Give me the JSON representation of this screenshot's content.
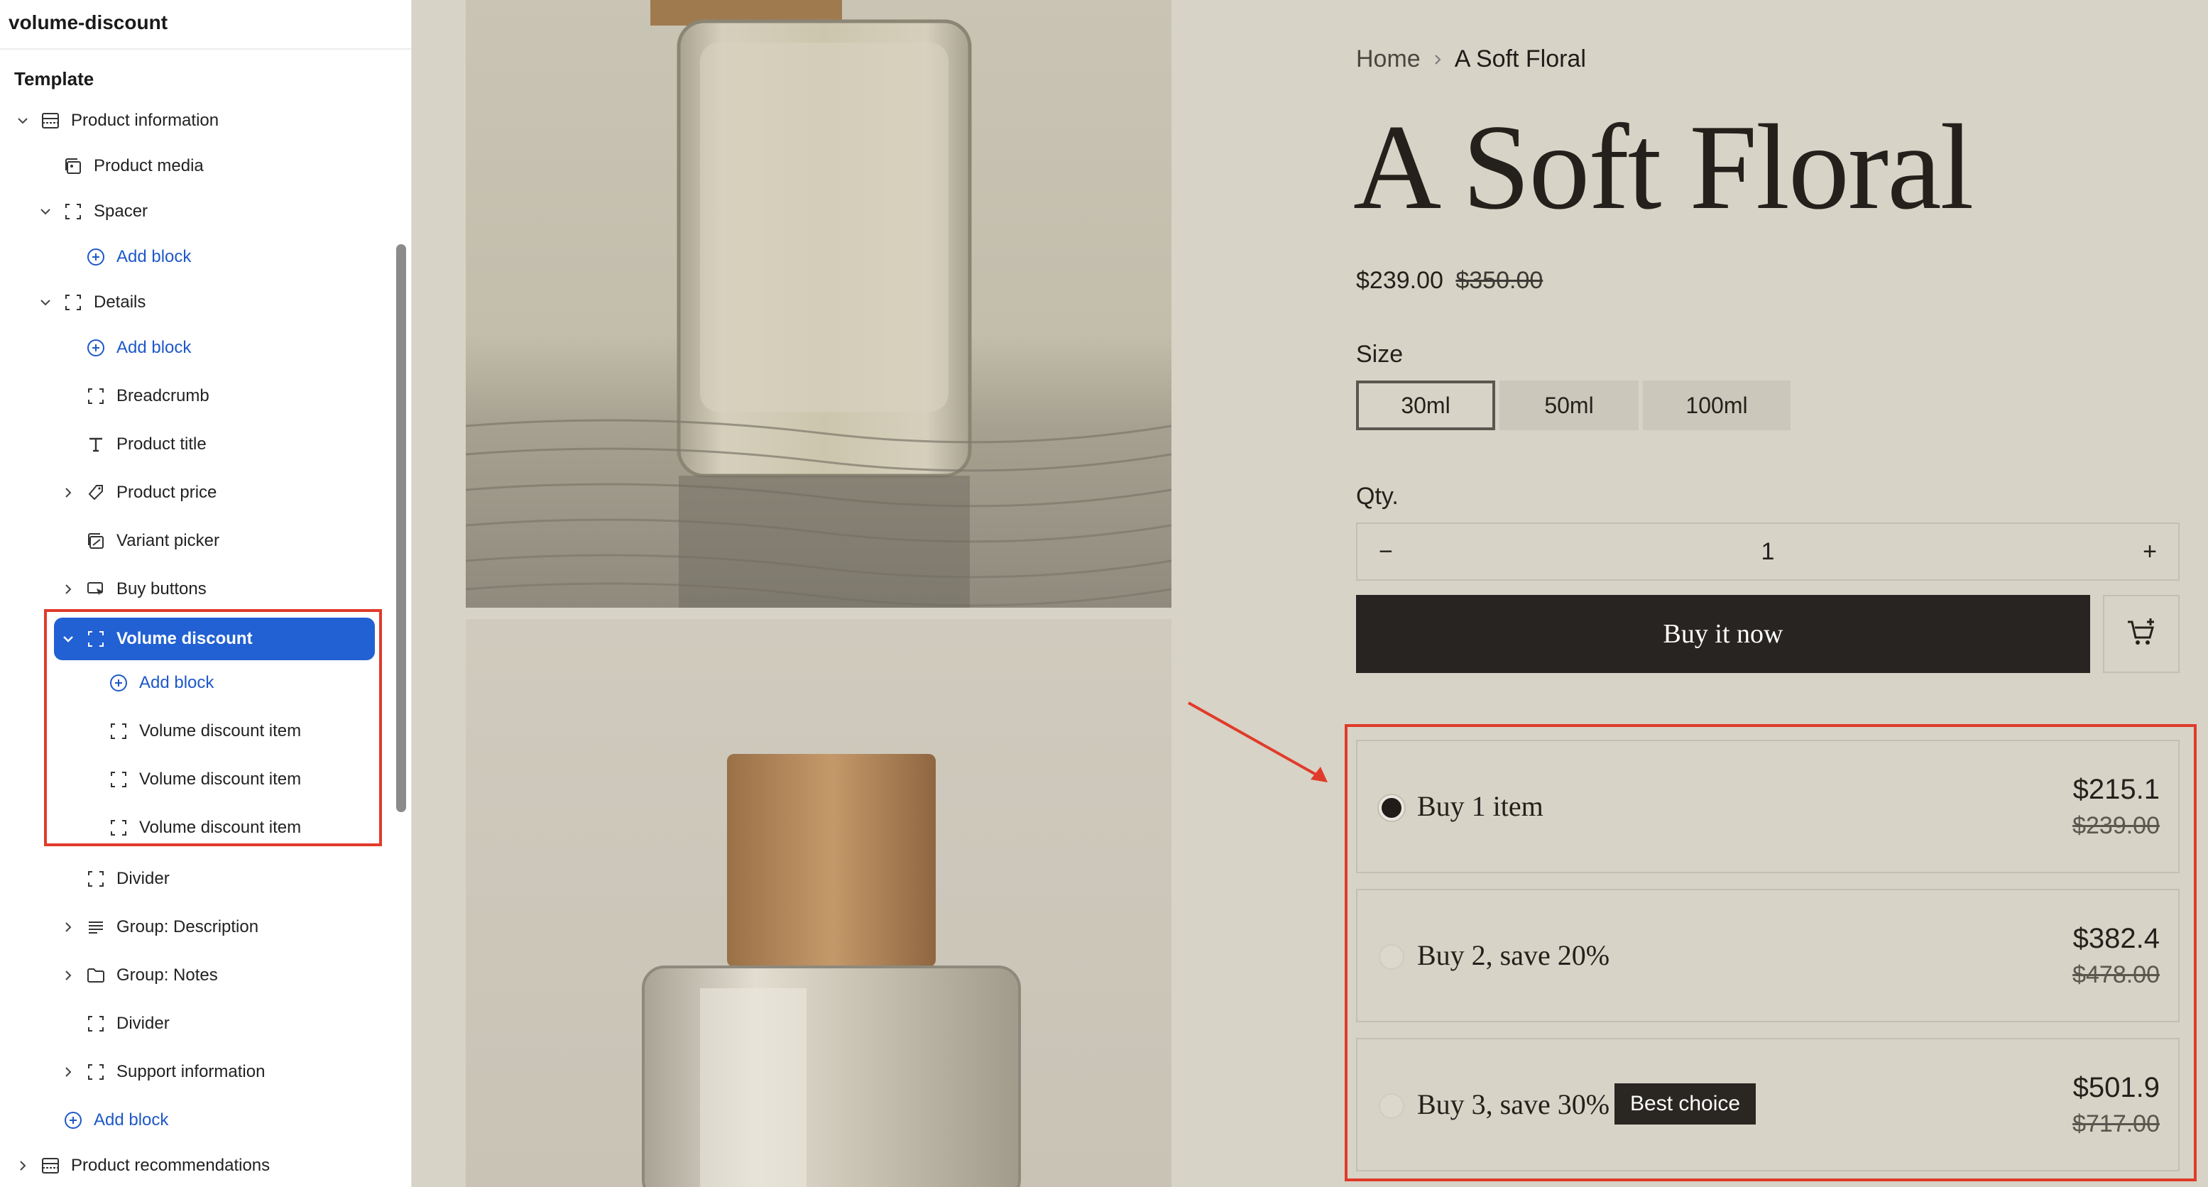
{
  "sidebar": {
    "header": "volume-discount",
    "section": "Template",
    "items": [
      {
        "label": "Product information",
        "icon": "section-icon"
      },
      {
        "label": "Product media",
        "icon": "media-icon"
      },
      {
        "label": "Spacer",
        "icon": "block-icon"
      },
      {
        "label": "Add block",
        "icon": "add-circle-icon"
      },
      {
        "label": "Details",
        "icon": "block-icon"
      },
      {
        "label": "Add block",
        "icon": "add-circle-icon"
      },
      {
        "label": "Breadcrumb",
        "icon": "block-icon"
      },
      {
        "label": "Product title",
        "icon": "text-icon"
      },
      {
        "label": "Product price",
        "icon": "price-icon"
      },
      {
        "label": "Variant picker",
        "icon": "variant-icon"
      },
      {
        "label": "Buy buttons",
        "icon": "cursor-icon"
      },
      {
        "label": "Volume discount",
        "icon": "block-icon"
      },
      {
        "label": "Add block",
        "icon": "add-circle-icon"
      },
      {
        "label": "Volume discount item",
        "icon": "block-icon"
      },
      {
        "label": "Volume discount item",
        "icon": "block-icon"
      },
      {
        "label": "Volume discount item",
        "icon": "block-icon"
      },
      {
        "label": "Divider",
        "icon": "block-icon"
      },
      {
        "label": "Group: Description",
        "icon": "lines-icon"
      },
      {
        "label": "Group: Notes",
        "icon": "folder-icon"
      },
      {
        "label": "Divider",
        "icon": "block-icon"
      },
      {
        "label": "Support information",
        "icon": "block-icon"
      },
      {
        "label": "Add block",
        "icon": "add-circle-icon"
      },
      {
        "label": "Product recommendations",
        "icon": "section-icon"
      }
    ]
  },
  "product": {
    "breadcrumb_home": "Home",
    "breadcrumb_current": "A Soft Floral",
    "title": "A Soft Floral",
    "price": "$239.00",
    "price_compare": "$350.00",
    "size_label": "Size",
    "sizes": [
      "30ml",
      "50ml",
      "100ml"
    ],
    "selected_size": "30ml",
    "qty_label": "Qty.",
    "qty_minus": "−",
    "qty_value": "1",
    "qty_plus": "+",
    "buy_label": "Buy it now"
  },
  "volume_discount": {
    "tiers": [
      {
        "label": "Buy 1 item",
        "price": "$215.1",
        "compare": "$239.00",
        "selected": true,
        "badge": ""
      },
      {
        "label": "Buy 2, save 20%",
        "price": "$382.4",
        "compare": "$478.00",
        "selected": false,
        "badge": ""
      },
      {
        "label": "Buy 3, save 30%",
        "price": "$501.9",
        "compare": "$717.00",
        "selected": false,
        "badge": "Best choice"
      }
    ]
  },
  "colors": {
    "accent_blue": "#2261d3",
    "annotation_red": "#e03b2a",
    "background": "#d7d3c6",
    "button_dark": "#282421"
  }
}
